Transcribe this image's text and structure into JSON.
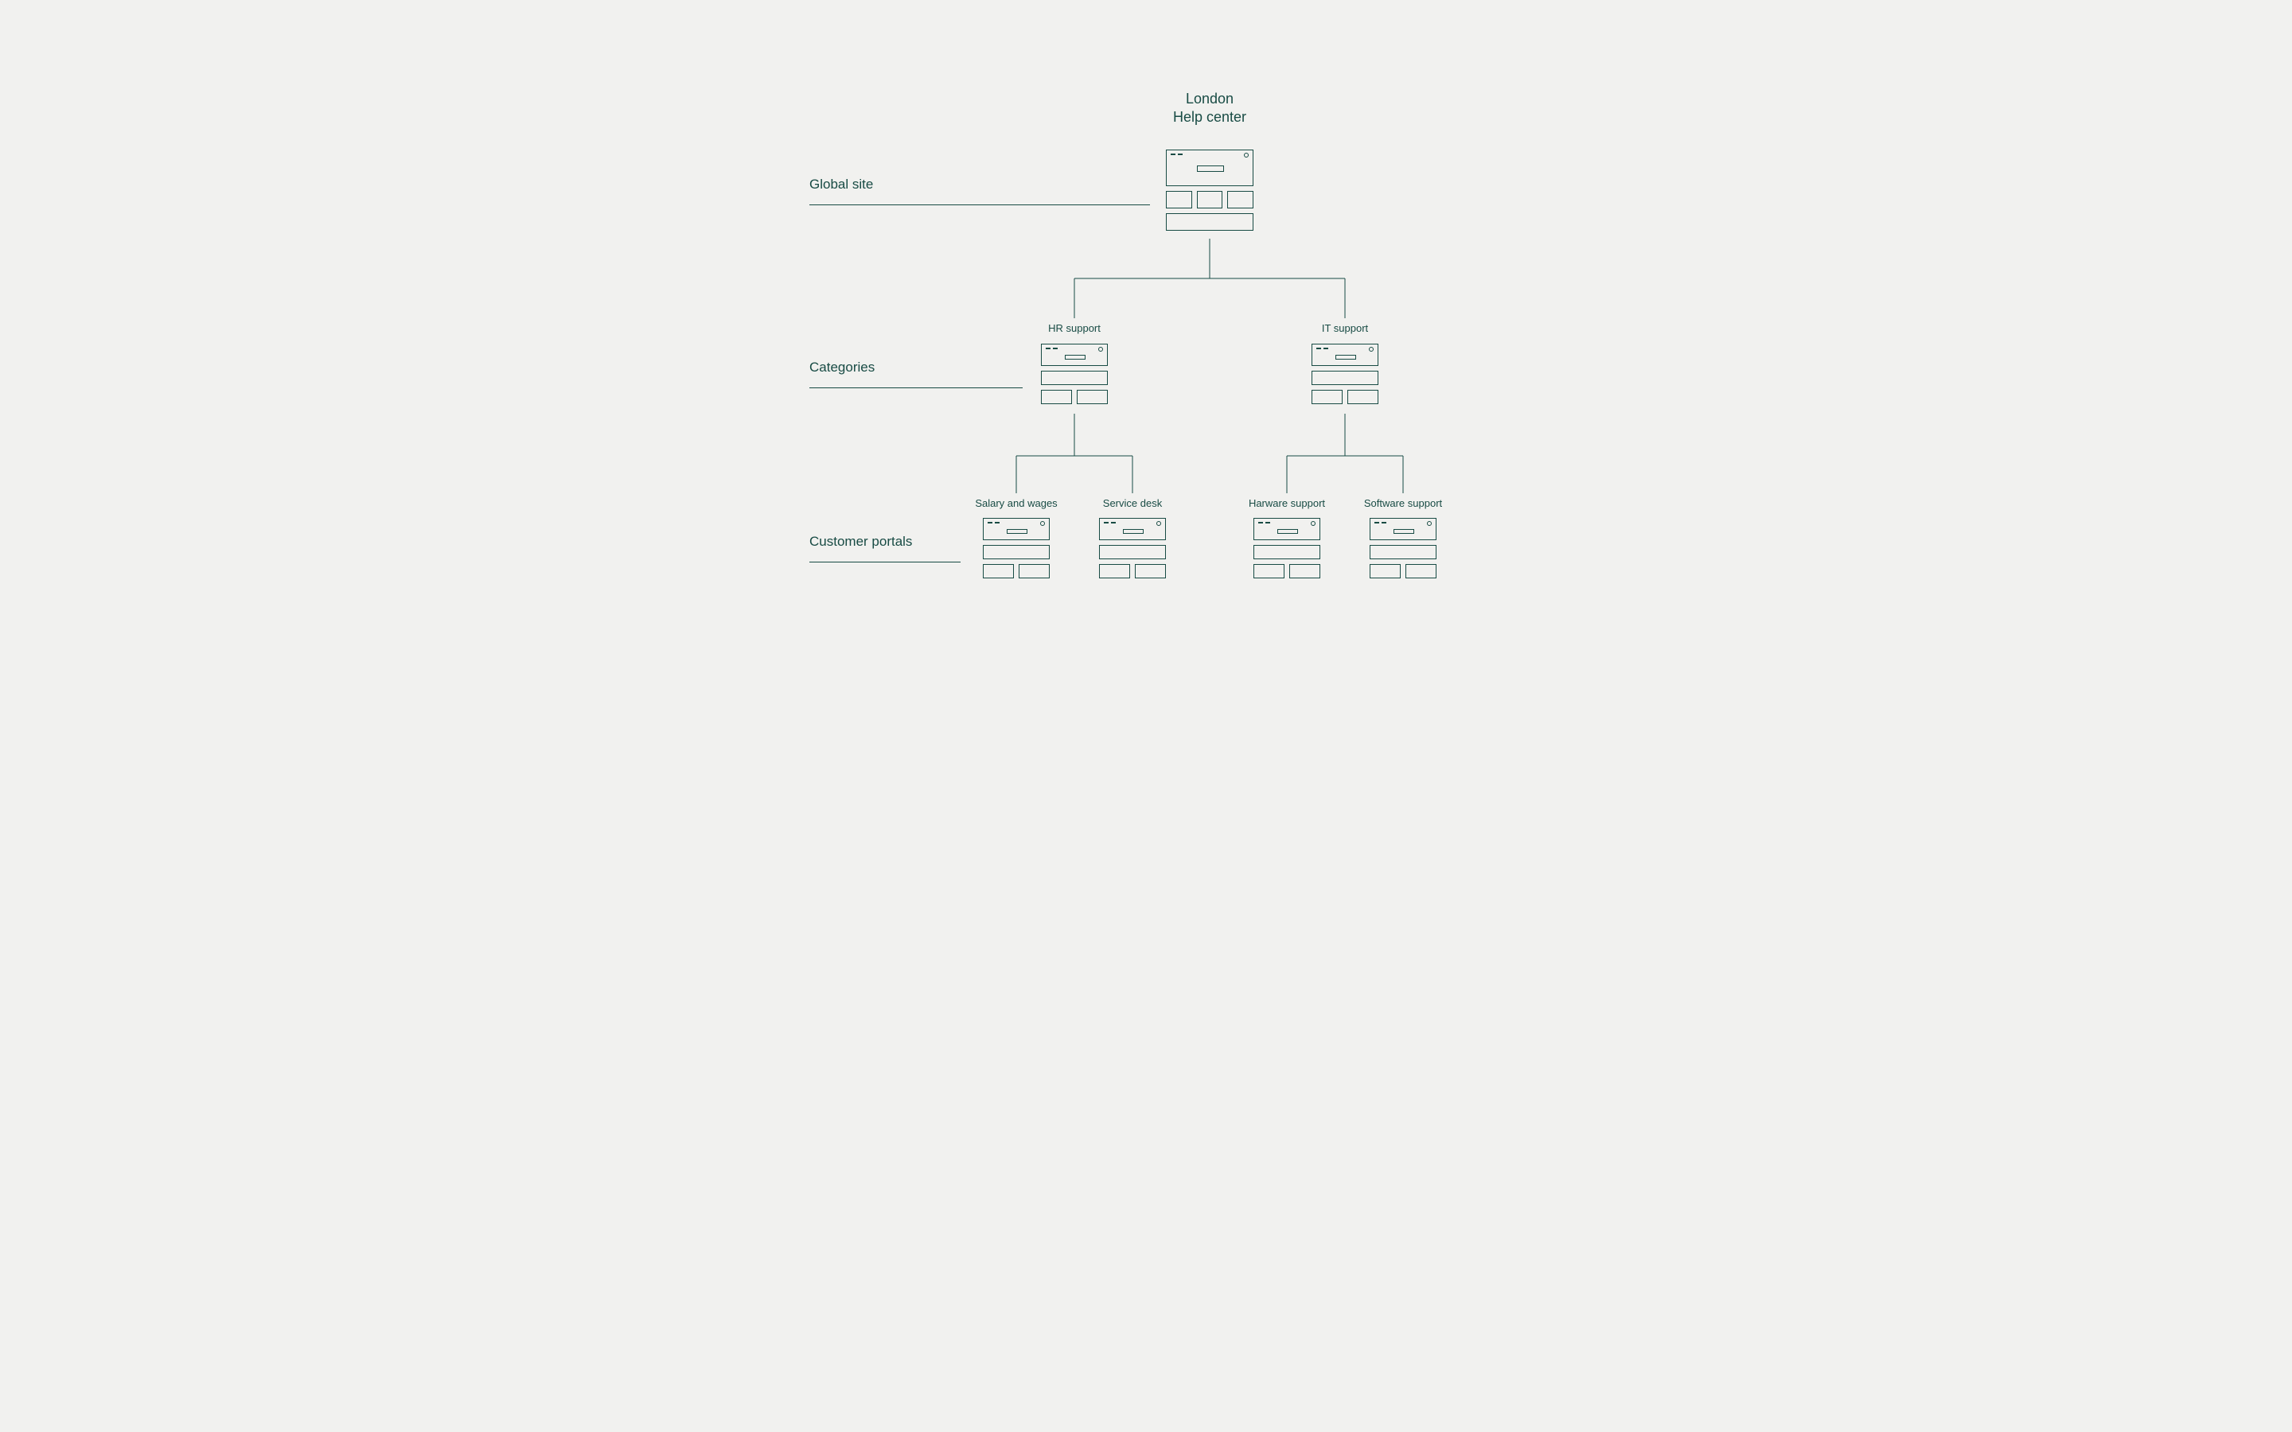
{
  "colors": {
    "ink": "#184b44",
    "bg": "#f1f1ef"
  },
  "title": {
    "line1": "London",
    "line2": "Help center"
  },
  "rows": {
    "global": "Global site",
    "categories": "Categories",
    "portals": "Customer portals"
  },
  "categories": {
    "hr": "HR support",
    "it": "IT support"
  },
  "portals": {
    "salary": "Salary and wages",
    "servicedesk": "Service desk",
    "hardware": "Harware support",
    "software": "Software support"
  }
}
